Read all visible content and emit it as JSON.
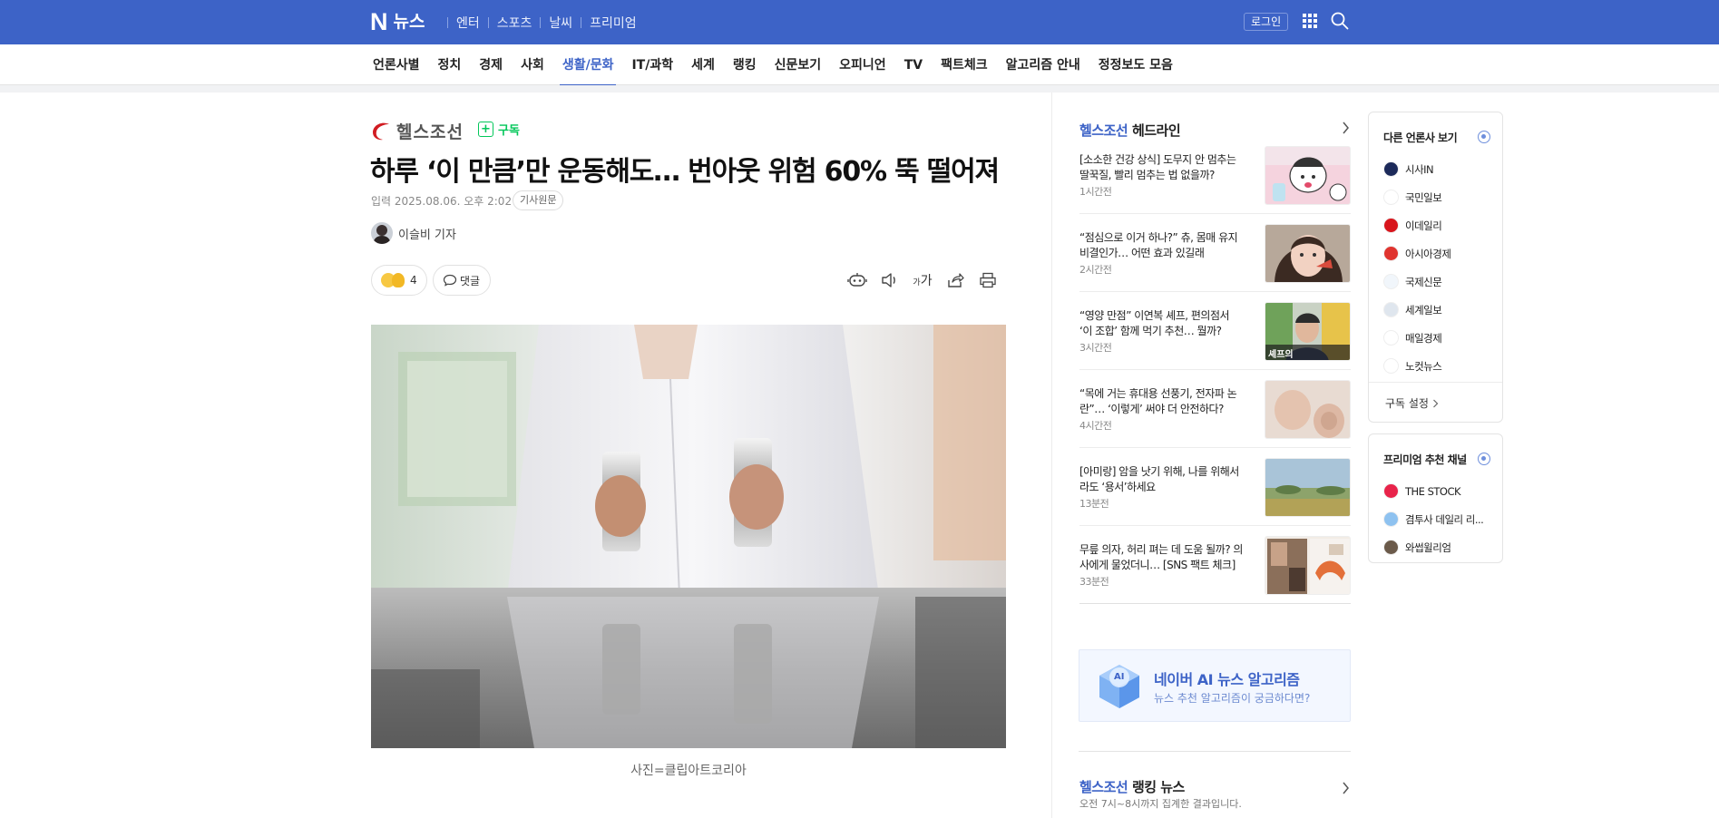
{
  "topbar": {
    "logo_n": "N",
    "logo_text": "뉴스",
    "links": [
      "엔터",
      "스포츠",
      "날씨",
      "프리미엄"
    ],
    "login": "로그인",
    "icons": [
      "apps-grid-icon",
      "search-icon"
    ]
  },
  "category_nav": {
    "items": [
      "언론사별",
      "정치",
      "경제",
      "사회",
      "생활/문화",
      "IT/과학",
      "세계",
      "랭킹",
      "신문보기",
      "오피니언",
      "TV",
      "팩트체크",
      "알고리즘 안내",
      "정정보도 모음"
    ],
    "active": "생활/문화"
  },
  "article": {
    "press": "헬스조선",
    "subscribe_plus": "+",
    "subscribe": "구독",
    "headline": "하루 ‘이 만큼’만 운동해도… 번아웃 위험 60% 뚝 떨어져",
    "date": "입력 2025.08.06. 오후 2:02",
    "origin_button": "기사원문",
    "reporter": "이슬비 기자",
    "reaction_count": "4",
    "comment_label": "댓글",
    "font_size_small": "가",
    "font_size_large": "가",
    "photo_caption": "사진=클립아트코리아"
  },
  "headline_list": {
    "press": "헬스조선",
    "title": "헤드라인",
    "items": [
      {
        "text": "[소소한 건강 상식] 도무지 안 멈추는 딸꾹질, 빨리 멈추는 법 없을까?",
        "time": "1시간전"
      },
      {
        "text": "“점심으로 이거 하나?” 츄, 몸매 유지 비결인가… 어떤 효과 있길래",
        "time": "2시간전"
      },
      {
        "text": "“영양 만점” 이연복 셰프, 편의점서 ‘이 조합’ 함께 먹기 추천… 뭘까?",
        "time": "3시간전"
      },
      {
        "text": "“목에 거는 휴대용 선풍기, 전자파 논란”… ‘이렇게’ 써야 더 안전하다?",
        "time": "4시간전"
      },
      {
        "text": "[아미랑] 암을 낫기 위해, 나를 위해서라도 ‘용서’하세요",
        "time": "13분전"
      },
      {
        "text": "무릎 의자, 허리 펴는 데 도움 될까? 의사에게 물었더니… [SNS 팩트 체크]",
        "time": "33분전"
      }
    ],
    "thumb3_caption": "셰프의"
  },
  "ai_banner": {
    "title": "네이버 AI 뉴스 알고리즘",
    "subtitle": "뉴스 추천 알고리즘이 궁금하다면?",
    "icon_text": "AI"
  },
  "ranking": {
    "press": "헬스조선",
    "title": "랭킹 뉴스",
    "subtitle": "오전 7시~8시까지 집계한 결과입니다."
  },
  "other_press": {
    "title": "다른 언론사 보기",
    "items": [
      {
        "name": "시사IN",
        "color": "#1c2a5a"
      },
      {
        "name": "국민일보",
        "color": "#ffffff"
      },
      {
        "name": "이데일리",
        "color": "#d8151c"
      },
      {
        "name": "아시아경제",
        "color": "#e0342f"
      },
      {
        "name": "국제신문",
        "color": "#f1f6fb"
      },
      {
        "name": "세계일보",
        "color": "#dfe6ee"
      },
      {
        "name": "매일경제",
        "color": "#ffffff"
      },
      {
        "name": "노컷뉴스",
        "color": "#ffffff"
      }
    ],
    "setting": "구독 설정"
  },
  "premium": {
    "title": "프리미엄 추천 채널",
    "items": [
      {
        "name": "THE STOCK",
        "color": "#e8234a"
      },
      {
        "name": "겸투사 데일리 리...",
        "color": "#8ec2f0"
      },
      {
        "name": "와썹윌리엄",
        "color": "#6b5a4a"
      }
    ]
  },
  "colors": {
    "brand_blue": "#3d63c7",
    "subscribe_green": "#03c75a"
  }
}
